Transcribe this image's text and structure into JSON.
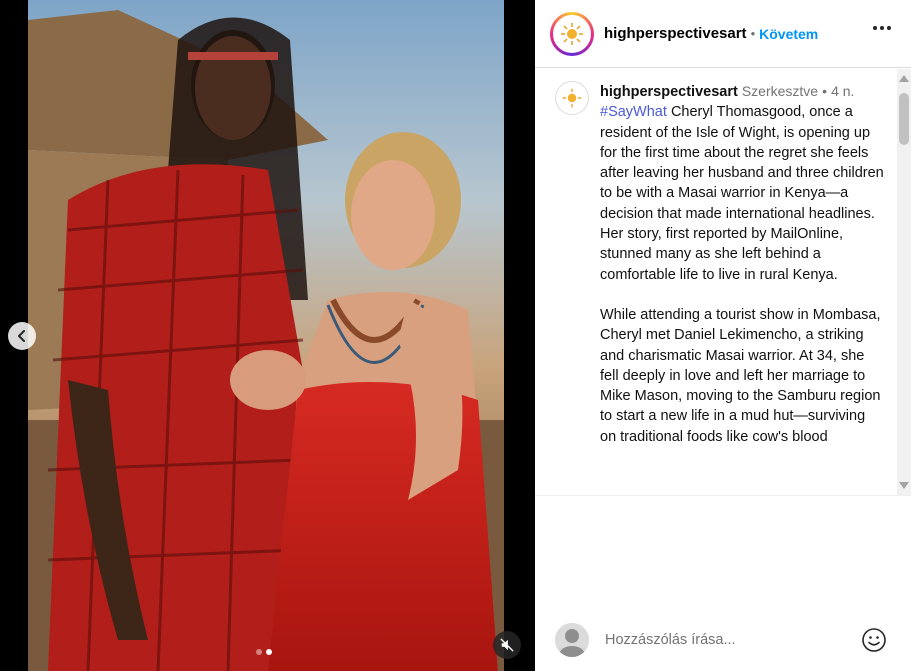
{
  "header": {
    "username": "highperspectivesart",
    "separator": "•",
    "follow_label": "Követem"
  },
  "caption": {
    "username": "highperspectivesart",
    "edited_label": "Szerkesztve",
    "separator": "•",
    "time": "4 n.",
    "hashtag": "#SayWhat",
    "paragraph1": "Cheryl Thomasgood, once a resident of the Isle of Wight, is opening up for the first time about the regret she feels after leaving her husband and three children to be with a Masai warrior in Kenya—a decision that made international headlines. Her story, first reported by MailOnline, stunned many as she left behind a comfortable life to live in rural Kenya.",
    "paragraph2": "While attending a tourist show in Mombasa, Cheryl met Daniel Lekimencho, a striking and charismatic Masai warrior. At 34, she fell deeply in love and left her marriage to Mike Mason, moving to the Samburu region to start a new life in a mud hut—surviving on traditional foods like cow's blood"
  },
  "comment": {
    "placeholder": "Hozzászólás írása..."
  },
  "carousel": {
    "total": 2,
    "active_index": 2
  },
  "icons": {
    "prev": "chevron-left-icon",
    "mute": "muted-speaker-icon",
    "more": "more-dots-icon",
    "emoji": "emoji-smile-icon"
  },
  "colors": {
    "follow": "#0095f6",
    "hashtag": "#4a5ad6",
    "text_muted": "#737373"
  }
}
